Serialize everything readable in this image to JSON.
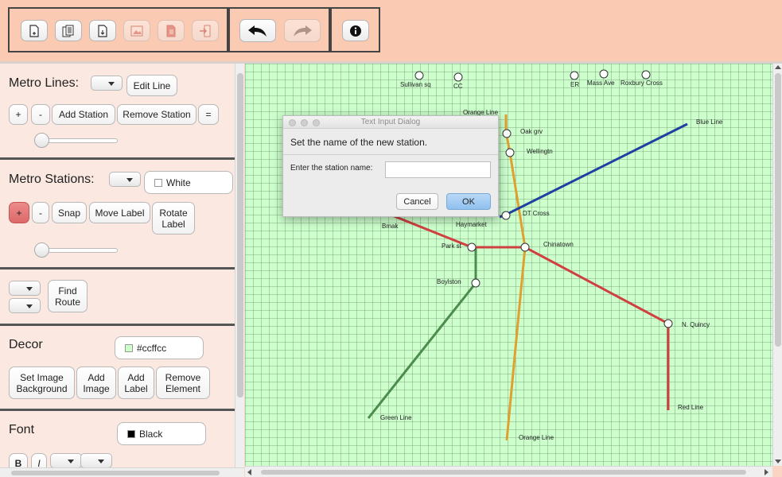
{
  "toolbar": {
    "buttons": [
      {
        "icon": "new-file-icon",
        "enabled": true
      },
      {
        "icon": "copy-file-icon",
        "enabled": true
      },
      {
        "icon": "open-file-icon",
        "enabled": true
      },
      {
        "icon": "save-image-icon",
        "enabled": false
      },
      {
        "icon": "export-file-icon",
        "enabled": false
      },
      {
        "icon": "exit-icon",
        "enabled": false
      },
      {
        "icon": "undo-icon",
        "enabled": true
      },
      {
        "icon": "redo-icon",
        "enabled": false
      },
      {
        "icon": "info-icon",
        "enabled": true
      }
    ]
  },
  "metro_lines": {
    "title": "Metro Lines:",
    "edit_label": "Edit Line",
    "add_label": "+",
    "remove_label": "-",
    "add_station_label": "Add Station",
    "remove_station_label": "Remove Station",
    "list_label": "=",
    "slider_value": 0
  },
  "metro_stations": {
    "title": "Metro Stations:",
    "color_name": "White",
    "color_hex": "#ffffff",
    "add_label": "+",
    "remove_label": "-",
    "snap_label": "Snap",
    "move_label": "Move Label",
    "rotate_label_1": "Rotate",
    "rotate_label_2": "Label",
    "slider_value": 0
  },
  "route": {
    "find_label_1": "Find",
    "find_label_2": "Route"
  },
  "decor": {
    "title": "Decor",
    "color_hex": "#ccffcc",
    "color_label": "#ccffcc",
    "set_bg_1": "Set Image",
    "set_bg_2": "Background",
    "add_image_1": "Add",
    "add_image_2": "Image",
    "add_label_1": "Add",
    "add_label_2": "Label",
    "remove_el_1": "Remove",
    "remove_el_2": "Element"
  },
  "font": {
    "title": "Font",
    "color_name": "Black",
    "color_hex": "#000000",
    "bold_label": "B",
    "italic_label": "I"
  },
  "map": {
    "background": "#ccffcc",
    "lines": [
      {
        "name": "Blue Line",
        "color": "#2040a0"
      },
      {
        "name": "Orange Line",
        "color": "#e0a030"
      },
      {
        "name": "Red Line",
        "color": "#d04040"
      },
      {
        "name": "Green Line",
        "color": "#4c8c4c"
      }
    ],
    "stations": [
      "Sullivan sq",
      "CC",
      "ER",
      "Mass Ave",
      "Roxbury Cross",
      "Oak grv",
      "Wellingtn",
      "DT Cross",
      "Haymarket",
      "Bmak",
      "Park st",
      "Chinatown",
      "Boylston",
      "N. Quincy"
    ],
    "line_labels": {
      "orange_top": "Orange Line",
      "blue": "Blue Line",
      "red": "Red Line",
      "green": "Green Line",
      "orange_bottom": "Orange Line"
    }
  },
  "dialog": {
    "title": "Text Input Dialog",
    "message": "Set the name of the new station.",
    "field_label": "Enter the station name:",
    "field_value": "",
    "cancel_label": "Cancel",
    "ok_label": "OK"
  }
}
